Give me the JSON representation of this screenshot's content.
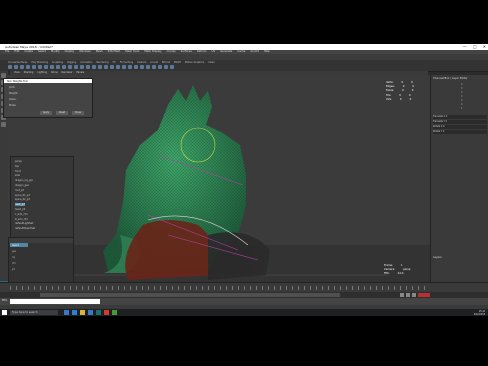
{
  "window": {
    "title": "Autodesk Maya 2018 - Untitled*",
    "controls": [
      "—",
      "□",
      "✕"
    ]
  },
  "menubar": [
    "File",
    "Edit",
    "Create",
    "Select",
    "Modify",
    "Display",
    "Windows",
    "Mesh",
    "Edit Mesh",
    "Mesh Tools",
    "Mesh Display",
    "Curves",
    "Surfaces",
    "Deform",
    "UV",
    "Generate",
    "Cache",
    "Arnold",
    "Help"
  ],
  "shelf": {
    "tabs": [
      "Curves/Surfaces",
      "Poly Modeling",
      "Sculpting",
      "Rigging",
      "Animation",
      "Rendering",
      "FX",
      "FX Caching",
      "Custom",
      "Arnold",
      "Bifrost",
      "MASH",
      "Motion Graphics",
      "XGen"
    ]
  },
  "viewport_menu": [
    "View",
    "Shading",
    "Lighting",
    "Show",
    "Renderer",
    "Panels"
  ],
  "float_window": {
    "title": "Skin Weights Tool",
    "rows": [
      "Joint:",
      "Weight:",
      "Value:",
      "Mode:"
    ],
    "buttons": [
      "Apply",
      "Reset",
      "Close"
    ]
  },
  "outliner": {
    "items": [
      "persp",
      "top",
      "front",
      "side",
      "dragon_rig_grp",
      "dragon_geo",
      "root_jnt",
      "spine_01_jnt",
      "spine_02_jnt",
      "neck_jnt",
      "head_jnt",
      "L_arm_ctrl",
      "R_arm_ctrl",
      "defaultLightSet",
      "defaultObjectSet"
    ],
    "selected_index": 9
  },
  "layers": {
    "rows": [
      "layer1",
      "geo",
      "rig",
      "ctrl",
      "jnt"
    ]
  },
  "hud_top": [
    [
      "Verts:",
      "0",
      "0"
    ],
    [
      "Edges:",
      "0",
      "0"
    ],
    [
      "Faces:",
      "0",
      "0"
    ],
    [
      "Tris:",
      "0",
      "0"
    ],
    [
      "UVs:",
      "0",
      "0"
    ]
  ],
  "hud_bottom": [
    [
      "Frame:",
      "1"
    ],
    [
      "Camera:",
      "persp"
    ],
    [
      "FPS:",
      "24.0"
    ]
  ],
  "channel_box": {
    "title": "Channel Box / Layer Editor",
    "attrs": [
      "0",
      "0",
      "0",
      "0",
      "0",
      "0",
      "1"
    ],
    "inputs": [
      "Translate X 0",
      "Translate Y 0",
      "Rotate X 0",
      "Rotate Y 0"
    ],
    "layers_label": "Layers"
  },
  "cmdline": {
    "label": "MEL"
  },
  "taskbar": {
    "search_placeholder": "Type here to search",
    "time": "15:42",
    "date": "4/22/2018"
  },
  "maya_logo": "M",
  "colors": {
    "accent": "#5285a6",
    "viewport": "#3b3b3b",
    "key": "#b43232"
  }
}
